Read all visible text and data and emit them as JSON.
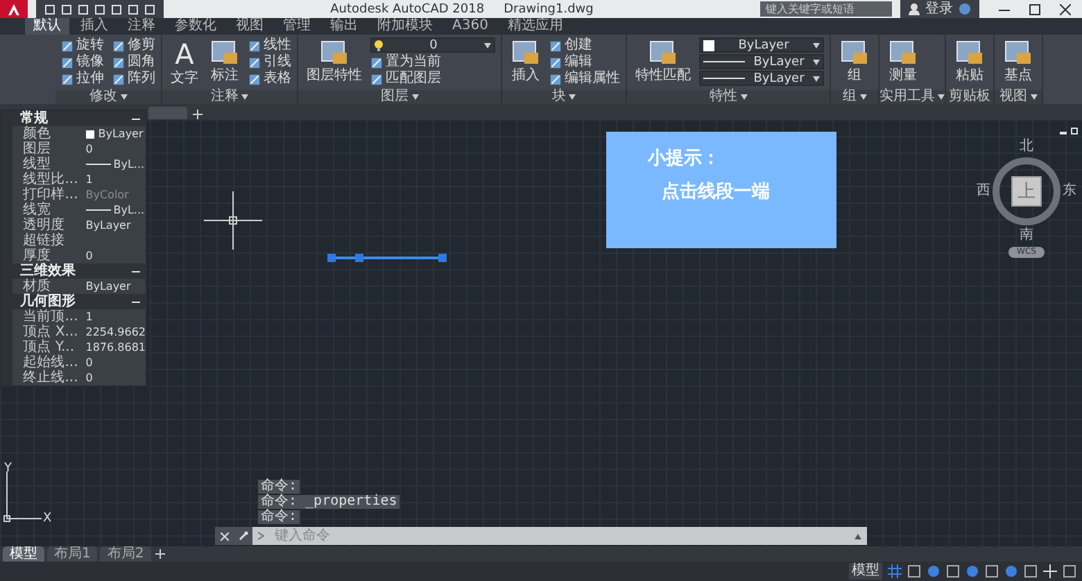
{
  "title_bar": {
    "app_title": "Autodesk AutoCAD 2018",
    "file_name": "Drawing1.dwg",
    "search_placeholder": "键入关键字或短语",
    "user": "登录"
  },
  "ribbon_tabs": [
    {
      "label": "默认",
      "selected": true
    },
    {
      "label": "插入",
      "selected": false
    },
    {
      "label": "注释",
      "selected": false
    },
    {
      "label": "参数化",
      "selected": false
    },
    {
      "label": "视图",
      "selected": false
    },
    {
      "label": "管理",
      "selected": false
    },
    {
      "label": "输出",
      "selected": false
    },
    {
      "label": "附加模块",
      "selected": false
    },
    {
      "label": "A360",
      "selected": false
    },
    {
      "label": "精选应用",
      "selected": false
    }
  ],
  "ribbon_panels": [
    {
      "title": "修改",
      "has_menu": true,
      "tools": [
        {
          "kind": "small",
          "label": "旋转"
        },
        {
          "kind": "small",
          "label": "镜像"
        },
        {
          "kind": "small",
          "label": "拉伸"
        },
        {
          "kind": "small",
          "label": "修剪"
        },
        {
          "kind": "small",
          "label": "圆角"
        },
        {
          "kind": "small",
          "label": "阵列"
        }
      ]
    },
    {
      "title": "注释",
      "has_menu": true,
      "tools": [
        {
          "kind": "large",
          "label": "文字",
          "glyph": "A"
        },
        {
          "kind": "large",
          "label": "标注"
        },
        {
          "kind": "small",
          "label": "线性"
        },
        {
          "kind": "small",
          "label": "引线"
        },
        {
          "kind": "small",
          "label": "表格"
        }
      ]
    },
    {
      "title": "图层",
      "has_menu": true,
      "tools": [
        {
          "kind": "large",
          "label": "图层特性"
        },
        {
          "kind": "dropdown",
          "label": "0"
        },
        {
          "kind": "small",
          "label": "置为当前"
        },
        {
          "kind": "small",
          "label": "匹配图层"
        }
      ]
    },
    {
      "title": "块",
      "has_menu": true,
      "tools": [
        {
          "kind": "large",
          "label": "插入"
        },
        {
          "kind": "small",
          "label": "创建"
        },
        {
          "kind": "small",
          "label": "编辑"
        },
        {
          "kind": "small",
          "label": "编辑属性"
        }
      ]
    },
    {
      "title": "特性",
      "has_menu": true,
      "tools": [
        {
          "kind": "large",
          "label": "特性匹配"
        },
        {
          "kind": "color-dropdown",
          "label": "ByLayer"
        },
        {
          "kind": "line-dropdown",
          "label": "ByLayer"
        },
        {
          "kind": "line-dropdown",
          "label": "ByLayer"
        }
      ]
    },
    {
      "title": "组",
      "has_menu": true,
      "tools": [
        {
          "kind": "large",
          "label": "组"
        }
      ]
    },
    {
      "title": "实用工具",
      "has_menu": true,
      "tools": [
        {
          "kind": "large",
          "label": "测量"
        }
      ]
    },
    {
      "title": "剪贴板",
      "has_menu": false,
      "tools": [
        {
          "kind": "large",
          "label": "粘贴"
        }
      ]
    },
    {
      "title": "视图",
      "has_menu": true,
      "tools": [
        {
          "kind": "large",
          "label": "基点"
        }
      ]
    }
  ],
  "properties_palette": {
    "sections": [
      {
        "title": "常规",
        "expanded": true,
        "rows": [
          {
            "label": "颜色",
            "value": "ByLayer",
            "kind": "color"
          },
          {
            "label": "图层",
            "value": "0",
            "kind": "text"
          },
          {
            "label": "线型",
            "value": "ByL...",
            "kind": "line"
          },
          {
            "label": "线型比...",
            "value": "1",
            "kind": "text"
          },
          {
            "label": "打印样...",
            "value": "ByColor",
            "kind": "disabled"
          },
          {
            "label": "线宽",
            "value": "ByL...",
            "kind": "line"
          },
          {
            "label": "透明度",
            "value": "ByLayer",
            "kind": "text"
          },
          {
            "label": "超链接",
            "kind": "text"
          },
          {
            "label": "厚度",
            "value": "0",
            "kind": "text"
          }
        ]
      },
      {
        "title": "三维效果",
        "expanded": true,
        "rows": [
          {
            "label": "材质",
            "value": "ByLayer",
            "kind": "text"
          }
        ]
      },
      {
        "title": "几何图形",
        "expanded": true,
        "rows": [
          {
            "label": "当前顶...",
            "value": "1",
            "kind": "text"
          },
          {
            "label": "顶点 X...",
            "value": "2254.9662",
            "kind": "text"
          },
          {
            "label": "顶点 Y...",
            "value": "1876.8681",
            "kind": "text"
          },
          {
            "label": "起始线...",
            "value": "0",
            "kind": "text"
          },
          {
            "label": "终止线...",
            "value": "0",
            "kind": "text"
          }
        ]
      }
    ]
  },
  "tip_box": {
    "title": "小提示：",
    "text": "点击线段一端"
  },
  "view_cube": {
    "face": "上",
    "north": "北",
    "south": "南",
    "west": "西",
    "east": "东",
    "coordinate_system": "WCS"
  },
  "ucs_icon": {
    "x": "X",
    "y": "Y"
  },
  "command_history": [
    "命令:",
    "命令: _properties",
    "命令:"
  ],
  "command_line": {
    "placeholder": "键入命令"
  },
  "layout_tabs": [
    {
      "label": "模型",
      "selected": true
    },
    {
      "label": "布局1",
      "selected": false
    },
    {
      "label": "布局2",
      "selected": false
    }
  ],
  "status_bar": {
    "space": "模型"
  }
}
